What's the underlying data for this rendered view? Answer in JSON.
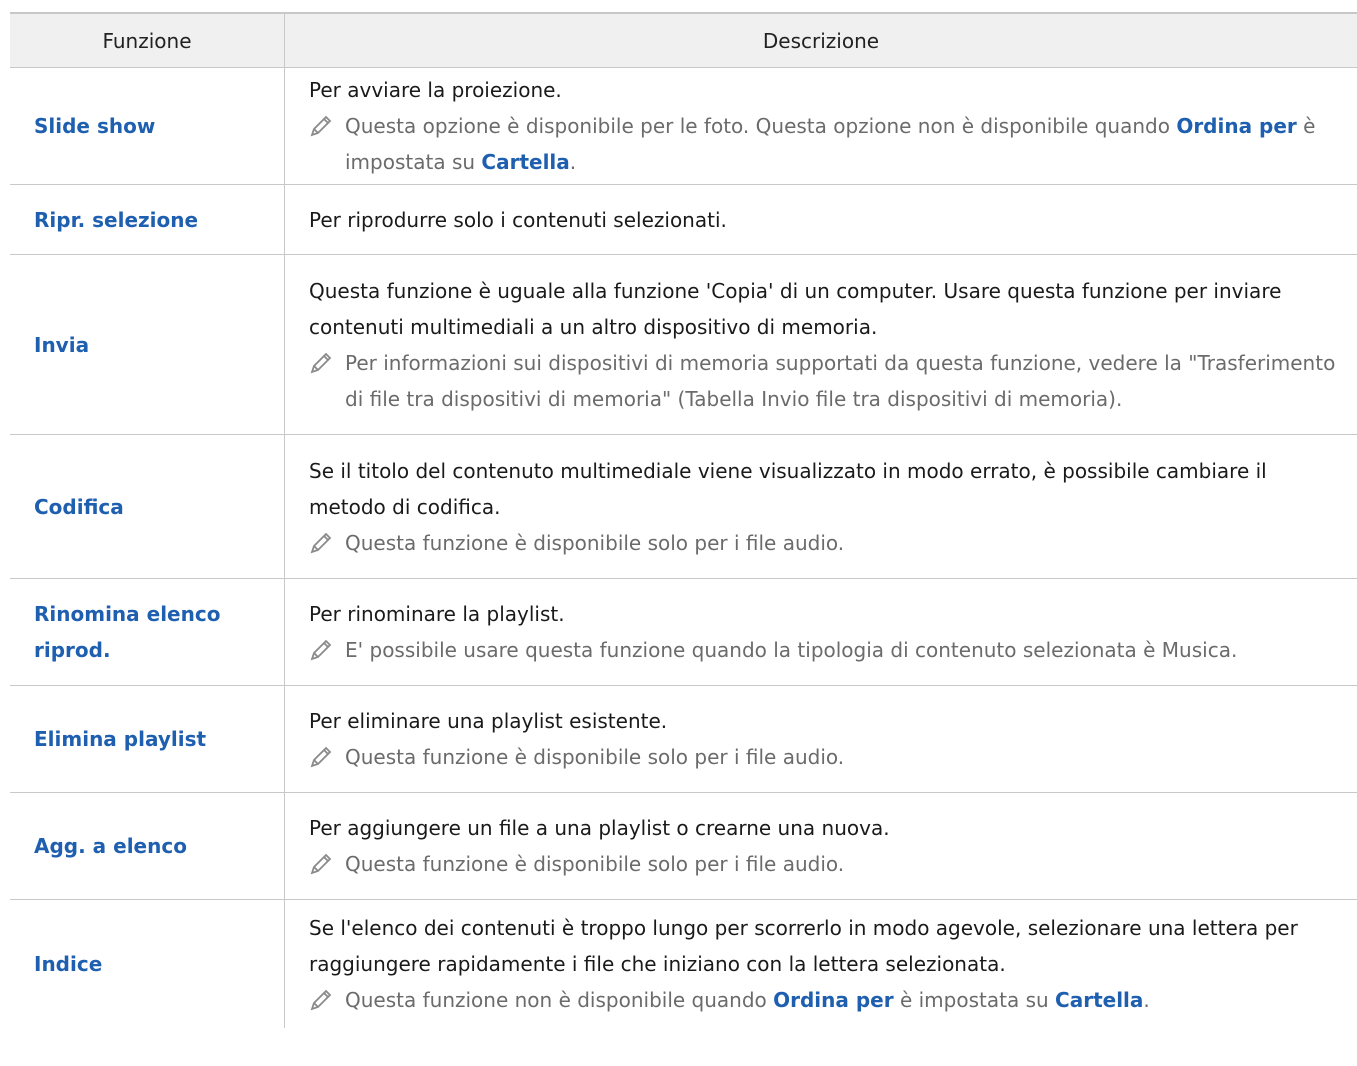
{
  "header": {
    "col_function": "Funzione",
    "col_description": "Descrizione"
  },
  "rows": [
    {
      "function": "Slide show",
      "text": "Per avviare la proiezione.",
      "note_parts": [
        "Questa opzione è disponibile per le foto. Questa opzione non è disponibile quando ",
        "Ordina per",
        " è impostata su ",
        "Cartella",
        "."
      ]
    },
    {
      "function": "Ripr. selezione",
      "text": "Per riprodurre solo i contenuti selezionati."
    },
    {
      "function": "Invia",
      "text": "Questa funzione è uguale alla funzione 'Copia' di un computer. Usare questa funzione per inviare contenuti multimediali a un altro dispositivo di memoria.",
      "note_parts": [
        "Per informazioni sui dispositivi di memoria supportati da questa funzione, vedere la \"Trasferimento di file tra dispositivi di memoria\" (Tabella Invio file tra dispositivi di memoria)."
      ]
    },
    {
      "function": "Codifica",
      "text": "Se il titolo del contenuto multimediale viene visualizzato in modo errato, è possibile cambiare il metodo di codifica.",
      "note_parts": [
        "Questa funzione è disponibile solo per i file audio."
      ]
    },
    {
      "function": "Rinomina elenco riprod.",
      "text": "Per rinominare la playlist.",
      "note_parts": [
        "E' possibile usare questa funzione quando la tipologia di contenuto selezionata è Musica."
      ]
    },
    {
      "function": "Elimina playlist",
      "text": "Per eliminare una playlist esistente.",
      "note_parts": [
        "Questa funzione è disponibile solo per i file audio."
      ]
    },
    {
      "function": "Agg. a elenco",
      "text": "Per aggiungere un file a una playlist o crearne una nuova.",
      "note_parts": [
        "Questa funzione è disponibile solo per i file audio."
      ]
    },
    {
      "function": "Indice",
      "text": "Se l'elenco dei contenuti è troppo lungo per scorrerlo in modo agevole, selezionare una lettera per raggiungere rapidamente i file che iniziano con la lettera selezionata.",
      "note_parts": [
        "Questa funzione non è disponibile quando ",
        "Ordina per",
        " è impostata su ",
        "Cartella",
        "."
      ]
    }
  ],
  "colors": {
    "accent": "#1f5fb0",
    "note_text": "#6b6b6b",
    "header_bg": "#f0f0f0",
    "border": "#c8c8c8"
  },
  "icons": {
    "note": "pencil-icon"
  }
}
